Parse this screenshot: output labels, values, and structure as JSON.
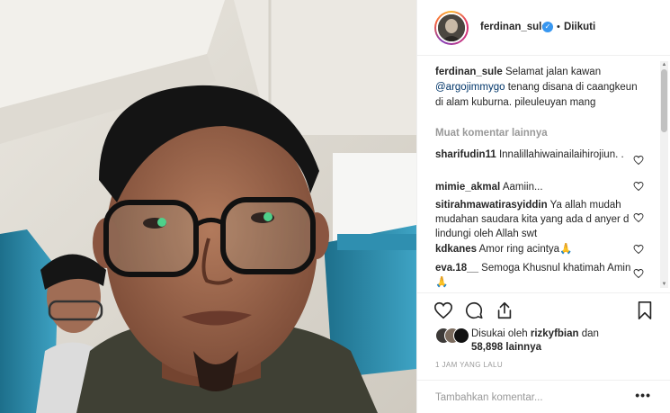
{
  "post": {
    "username": "ferdinan_sule",
    "verified_mark": "✓",
    "dot": "•",
    "follow_status": "Diikuti"
  },
  "caption": {
    "username": "ferdinan_sule",
    "text_before": "Selamat jalan kawan",
    "mention": "@argojimmygo",
    "text_after": "tenang disana di caangkeun di alam kuburna. pileuleuyan mang"
  },
  "more_comments": "Muat komentar lainnya",
  "comments": [
    {
      "user": "sharifudin11",
      "text": "Innalillahiwainailaihirojiun. ."
    },
    {
      "user": "mimie_akmal",
      "text": "Aamiin..."
    },
    {
      "user": "sitirahmawatirasyiddin",
      "text": "Ya allah mudah mudahan saudara kita yang ada d anyer d lindungi oleh Allah swt"
    },
    {
      "user": "kdkanes",
      "text": "Amor ring acintya🙏"
    },
    {
      "user": "eva.18__",
      "text": "Semoga Khusnul khatimah Amin 🙏"
    }
  ],
  "likes": {
    "prefix": "Disukai oleh",
    "user": "rizkyfbian",
    "conj": "dan",
    "count": "58,898 lainnya"
  },
  "timestamp": "1 JAM YANG LALU",
  "add_comment_placeholder": "Tambahkan komentar...",
  "more_options": "•••",
  "icons": {
    "like": "heart-icon",
    "comment": "comment-icon",
    "share": "share-icon",
    "save": "bookmark-icon"
  },
  "colors": {
    "verified": "#3897f0",
    "mention": "#003569",
    "muted": "#999999",
    "text": "#262626"
  }
}
